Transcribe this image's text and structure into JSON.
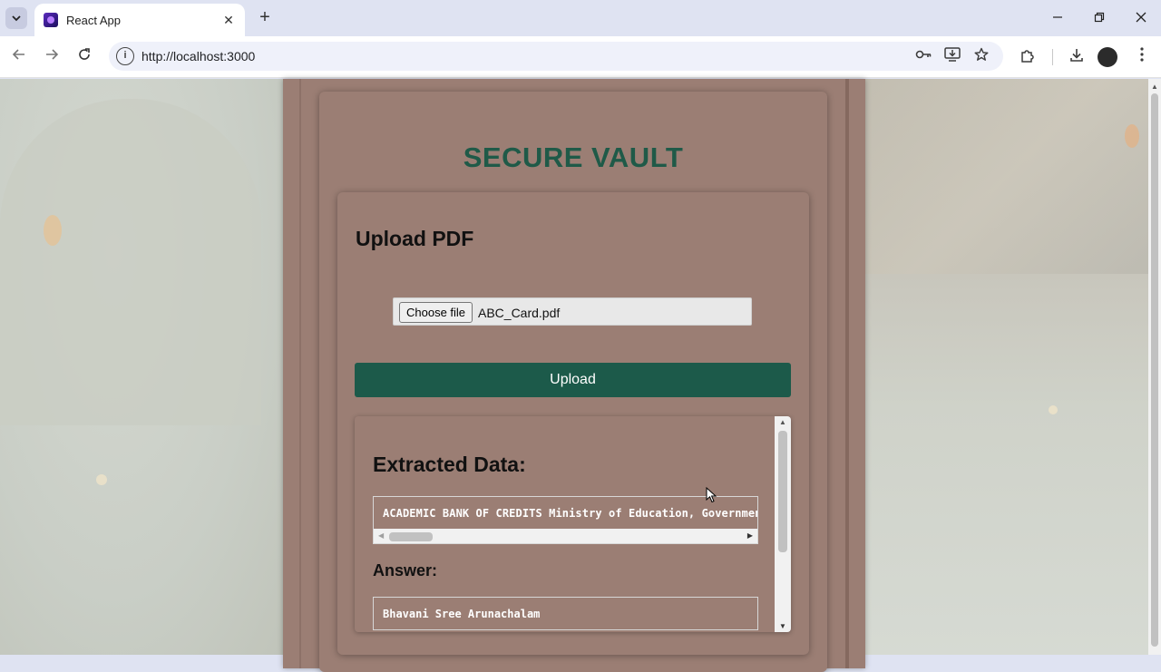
{
  "browser": {
    "tab_title": "React App",
    "tab_close": "✕",
    "new_tab": "+",
    "url": "http://localhost:3000",
    "window_controls": {
      "minimize": "—",
      "restore": "❐",
      "close": "✕"
    }
  },
  "app": {
    "title": "SECURE VAULT",
    "upload_heading": "Upload PDF",
    "choose_file_label": "Choose file",
    "file_name": "ABC_Card.pdf",
    "upload_button": "Upload",
    "extracted_heading": "Extracted Data:",
    "extracted_text": "ACADEMIC BANK OF CREDITS Ministry of Education, Government",
    "answer_heading": "Answer:",
    "answer_text": "Bhavani Sree Arunachalam"
  },
  "colors": {
    "accent_green": "#1c5a4a",
    "title_green": "#1f5a48",
    "card_brown": "#9b7e74"
  }
}
